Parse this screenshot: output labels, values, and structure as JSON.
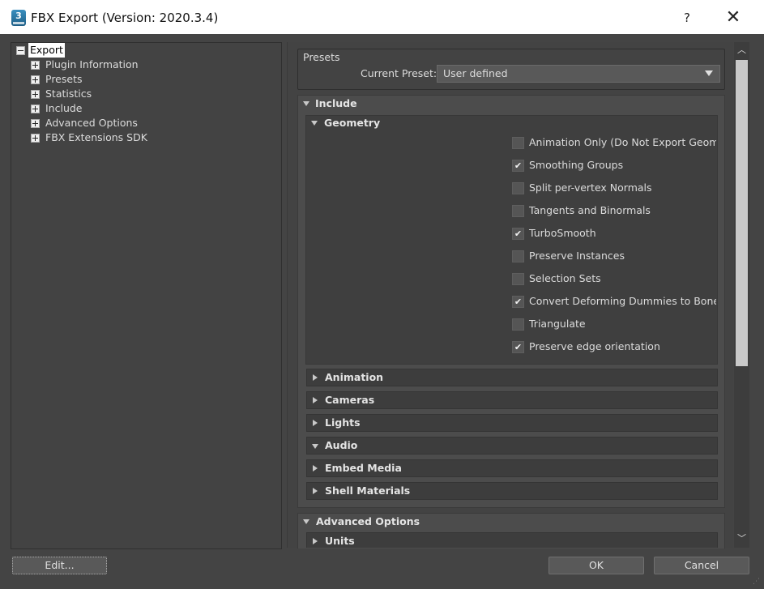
{
  "window": {
    "title": "FBX Export (Version: 2020.3.4)",
    "help_glyph": "?",
    "close_glyph": "✕",
    "icon_digit": "3"
  },
  "tree": {
    "root": "Export",
    "children": [
      "Plugin Information",
      "Presets",
      "Statistics",
      "Include",
      "Advanced Options",
      "FBX Extensions SDK"
    ]
  },
  "presets": {
    "title": "Presets",
    "current_label": "Current Preset:",
    "current_value": "User defined"
  },
  "include": {
    "title": "Include",
    "geometry": {
      "title": "Geometry",
      "options": [
        {
          "label": "Animation Only (Do Not Export Geometry)",
          "checked": false
        },
        {
          "label": "Smoothing Groups",
          "checked": true
        },
        {
          "label": "Split per-vertex Normals",
          "checked": false
        },
        {
          "label": "Tangents and Binormals",
          "checked": false
        },
        {
          "label": "TurboSmooth",
          "checked": true
        },
        {
          "label": "Preserve Instances",
          "checked": false
        },
        {
          "label": "Selection Sets",
          "checked": false
        },
        {
          "label": "Convert Deforming Dummies to Bones",
          "checked": true
        },
        {
          "label": "Triangulate",
          "checked": false
        },
        {
          "label": "Preserve edge orientation",
          "checked": true
        }
      ]
    },
    "sections": [
      "Animation",
      "Cameras",
      "Lights",
      "Audio",
      "Embed Media",
      "Shell Materials"
    ]
  },
  "advanced": {
    "title": "Advanced Options",
    "sections": [
      "Units"
    ]
  },
  "buttons": {
    "edit": "Edit...",
    "ok": "OK",
    "cancel": "Cancel"
  },
  "check_glyph": "✔"
}
